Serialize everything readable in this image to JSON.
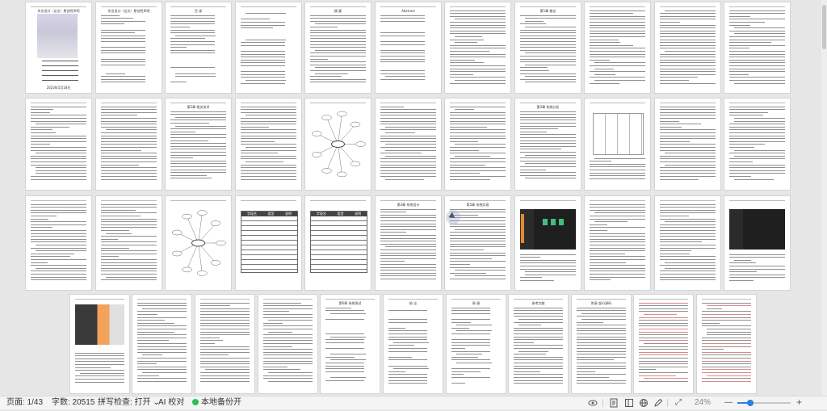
{
  "app": {
    "zoom_percent": 24
  },
  "pages": {
    "cover_title": "毕业设计（论文）原创性声明",
    "toc_title": "目    录",
    "abstract_title": "摘  要",
    "abstract_en_title": "Abstract",
    "ch1_title": "第1章 绪论",
    "ch2_title": "第2章 相关技术",
    "ch3_title": "第3章 系统分析",
    "ch4_title": "第4章 系统设计",
    "ch5_title": "第5章 系统实现",
    "ch6_title": "第6章 系统测试",
    "conclusion_title": "结    论",
    "thanks_title": "致    谢",
    "refs_title": "参考文献",
    "appendix_title": "附录 部分源码",
    "cover_stamp": "2023年5月18日",
    "table_header_field": "字段名",
    "table_header_type": "类型",
    "table_header_note": "说明"
  },
  "status": {
    "page_label": "页面: 1/43",
    "word_count": "字数: 20515",
    "spell_check": "拼写检查: 打开",
    "spell_check_chevron": "⌄",
    "ai_proofread": "AI 校对",
    "backup": "本地备份开",
    "zoom_text": "24%",
    "zoom_minus": "—",
    "zoom_plus": "+",
    "fit_icon": "⤢",
    "colors": {
      "backup_ok": "#2fbf4e",
      "zoom_accent": "#2f7de1"
    },
    "icons": [
      "eye-icon",
      "page-view-icon",
      "outline-view-icon",
      "web-view-icon",
      "write-mode-icon",
      "fit-screen-icon",
      "zoom-out-icon",
      "zoom-in-icon"
    ]
  }
}
